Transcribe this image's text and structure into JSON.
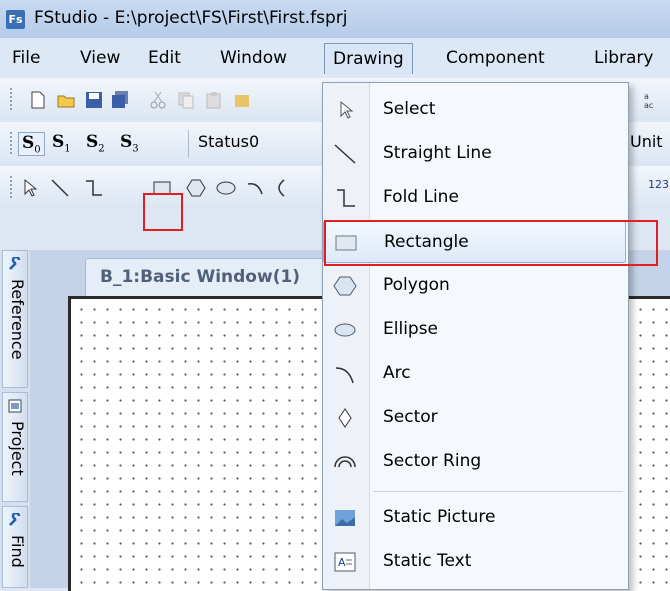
{
  "window": {
    "app_badge": "Fs",
    "title": "FStudio - E:\\project\\FS\\First\\First.fsprj"
  },
  "menubar": [
    {
      "label": "File"
    },
    {
      "label": "View"
    },
    {
      "label": "Edit"
    },
    {
      "label": "Window"
    },
    {
      "label": "Drawing"
    },
    {
      "label": "Component"
    },
    {
      "label": "Library"
    }
  ],
  "status_toolbar": {
    "s0": "S",
    "s0_sub": "0",
    "s1": "S",
    "s1_sub": "1",
    "s2": "S",
    "s2_sub": "2",
    "s3": "S",
    "s3_sub": "3",
    "status_value": "Status0",
    "unit_label": "Unit"
  },
  "drawing_toolbar": {
    "number_label": "123"
  },
  "side_tabs": {
    "reference": "Reference",
    "project": "Project",
    "find": "Find"
  },
  "document": {
    "tab_title": "B_1:Basic Window(1)"
  },
  "drawing_menu": {
    "items": [
      {
        "label": "Select",
        "icon": "pointer-icon"
      },
      {
        "label": "Straight Line",
        "icon": "straight-line-icon"
      },
      {
        "label": "Fold Line",
        "icon": "fold-line-icon"
      },
      {
        "label": "Rectangle",
        "icon": "rectangle-icon"
      },
      {
        "label": "Polygon",
        "icon": "polygon-icon"
      },
      {
        "label": "Ellipse",
        "icon": "ellipse-icon"
      },
      {
        "label": "Arc",
        "icon": "arc-icon"
      },
      {
        "label": "Sector",
        "icon": "sector-icon"
      },
      {
        "label": "Sector Ring",
        "icon": "sector-ring-icon"
      },
      {
        "label": "Static Picture",
        "icon": "static-picture-icon"
      },
      {
        "label": "Static Text",
        "icon": "static-text-icon"
      }
    ],
    "highlighted": "Rectangle"
  },
  "colors": {
    "highlight_box": "#e02020",
    "accent": "#3a6fb6"
  }
}
